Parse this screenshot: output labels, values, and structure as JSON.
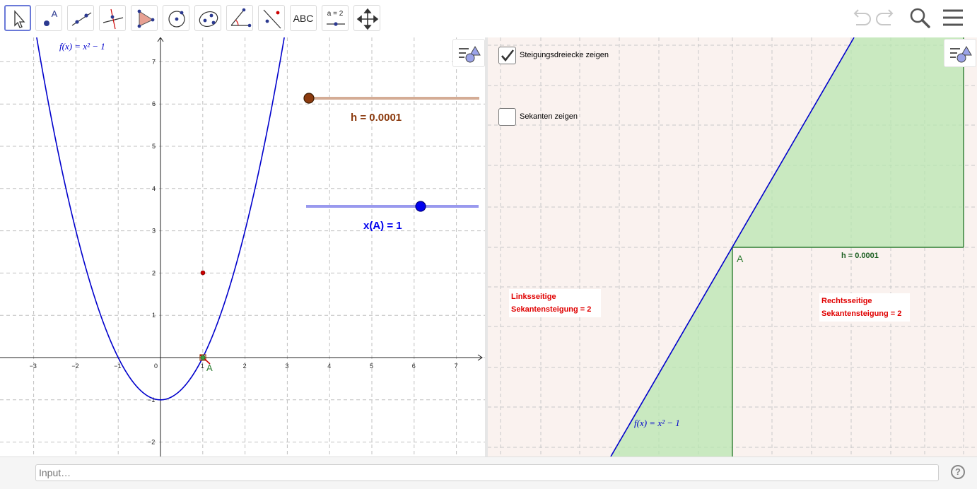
{
  "toolbar": {
    "tools": [
      {
        "name": "move-tool",
        "icon": "arrow-pointer-icon"
      },
      {
        "name": "point-tool",
        "icon": "point-icon",
        "label": "A"
      },
      {
        "name": "line-tool",
        "icon": "line-icon"
      },
      {
        "name": "perpendicular-line-tool",
        "icon": "perpendicular-icon"
      },
      {
        "name": "polygon-tool",
        "icon": "polygon-icon"
      },
      {
        "name": "circle-tool",
        "icon": "circle-center-point-icon"
      },
      {
        "name": "ellipse-tool",
        "icon": "ellipse-icon"
      },
      {
        "name": "angle-tool",
        "icon": "angle-icon"
      },
      {
        "name": "reflect-tool",
        "icon": "reflect-line-icon"
      },
      {
        "name": "text-tool",
        "icon": "text-icon",
        "label": "ABC"
      },
      {
        "name": "slider-tool",
        "icon": "slider-icon",
        "label": "a = 2"
      },
      {
        "name": "move-view-tool",
        "icon": "move-view-icon"
      }
    ],
    "right_icons": [
      "undo-icon",
      "redo-icon",
      "search-icon",
      "menu-icon"
    ]
  },
  "graphics1": {
    "function_label": "f(x) = x² − 1",
    "function": {
      "f": "x^2 - 1",
      "color": "#0000cc"
    },
    "x_ticks": [
      "−3",
      "−2",
      "−1",
      "0",
      "1",
      "2",
      "3",
      "4",
      "5",
      "6",
      "7"
    ],
    "y_ticks": [
      "−2",
      "−1",
      "1",
      "2",
      "3",
      "4",
      "5",
      "6",
      "7"
    ],
    "point_A": {
      "label": "A",
      "x": 1,
      "y": 0,
      "color": "#2e7d32"
    },
    "red_point": {
      "x": 1,
      "y": 2,
      "color": "#cc0000"
    },
    "slider_h": {
      "label": "h = 0.0001",
      "value": 0.0001,
      "color": "#8b3a0e",
      "track_color": "#d4ac95"
    },
    "slider_xA": {
      "label": "x(A) = 1",
      "value": 1,
      "color": "#0000ee",
      "track_color": "#9999ee"
    }
  },
  "graphics2": {
    "checkbox_triangles": {
      "label": "Steigungsdreiecke zeigen",
      "checked": true
    },
    "checkbox_secants": {
      "label": "Sekanten zeigen",
      "checked": false
    },
    "point_A_label": "A",
    "h_label": "h = 0.0001",
    "left_secant_line1": "Linksseitige",
    "left_secant_line2": "Sekantensteigung = 2",
    "right_secant_line1": "Rechtsseitige",
    "right_secant_line2": "Sekantensteigung = 2",
    "function_label": "f(x) = x² − 1",
    "colors": {
      "triangle_fill": "#b8e6b0",
      "triangle_edge": "#2e7d32",
      "curve": "#0000cc",
      "label_text": "#e00000"
    }
  },
  "bottom": {
    "input_placeholder": "Input…",
    "help_icon": "help-icon",
    "help_text": "?"
  }
}
